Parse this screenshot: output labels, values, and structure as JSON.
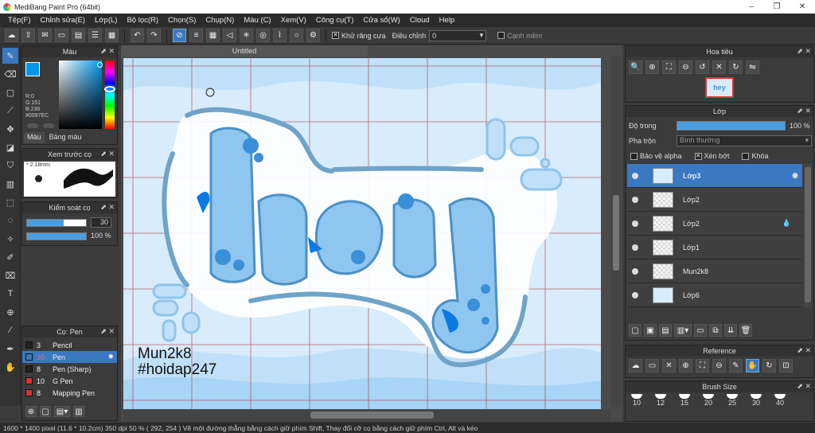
{
  "app": {
    "title": "MediBang Paint Pro (64bit)"
  },
  "window_buttons": [
    "–",
    "❐",
    "✕"
  ],
  "menu": [
    "Tệp(F)",
    "Chỉnh sửa(E)",
    "Lớp(L)",
    "Bộ lọc(R)",
    "Chọn(S)",
    "Chụp(N)",
    "Màu (C)",
    "Xem(V)",
    "Công cụ(T)",
    "Cửa sổ(W)",
    "Cloud",
    "Help"
  ],
  "toolbar": {
    "antialias_label": "Khử răng cưa",
    "adjust_label": "Điều chỉnh",
    "adjust_value": "0",
    "edge_label": "Cạnh mềm"
  },
  "color_panel": {
    "title": "Màu",
    "r": "R:0",
    "g": "G:151",
    "b": "B:236",
    "hex": "#0097EC",
    "tab1": "Màu",
    "tab2": "Bảng màu",
    "fg_color": "#0097EC"
  },
  "brush_preview": {
    "title": "Xem trước cọ",
    "size": "2.18mm"
  },
  "brush_control": {
    "title": "Kiểm soát cọ",
    "size_value": "30",
    "opacity_value": "100 %"
  },
  "brush_list": {
    "title": "Cọ: Pen",
    "items": [
      {
        "num": "3",
        "name": "Pencil",
        "color": "#222222"
      },
      {
        "num": "30",
        "name": "Pen",
        "color": "#3a78c2"
      },
      {
        "num": "8",
        "name": "Pen (Sharp)",
        "color": "#222222"
      },
      {
        "num": "10",
        "name": "G Pen",
        "color": "#e03030"
      },
      {
        "num": "8",
        "name": "Mapping Pen",
        "color": "#e03030"
      }
    ]
  },
  "document": {
    "tab": "Untitled",
    "word": "hey",
    "signature1": "Mun2k8",
    "signature2": "#hoidap247"
  },
  "navigator": {
    "title": "Hoa tiêu"
  },
  "layers": {
    "title": "Lớp",
    "opacity_label": "Độ trong",
    "opacity_value": "100 %",
    "opacity_level": 1.0,
    "blend_label": "Pha trộn",
    "blend_value": "Bình thường",
    "protect_alpha": "Bảo vệ alpha",
    "clip": "Xén bớt",
    "lock": "Khóa",
    "items": [
      {
        "name": "Lớp3",
        "selected": true
      },
      {
        "name": "Lớp2",
        "selected": false
      },
      {
        "name": "Lớp2",
        "selected": false
      },
      {
        "name": "Lớp1",
        "selected": false
      },
      {
        "name": "Mun2k8",
        "selected": false
      },
      {
        "name": "Lớp6",
        "selected": false
      }
    ]
  },
  "reference": {
    "title": "Reference"
  },
  "brush_size": {
    "title": "Brush Size",
    "sizes": [
      "10",
      "12",
      "15",
      "20",
      "25",
      "30",
      "40"
    ]
  },
  "status": {
    "text": "1600 * 1400 pixel   (11.6 * 10.2cm)   350 dpi   50 %   ( 292, 254 )  Vẽ một đường thẳng bằng cách giữ phím Shift, Thay đổi cỡ cọ bằng cách giữ phím Ctrl, Alt và kéo"
  }
}
